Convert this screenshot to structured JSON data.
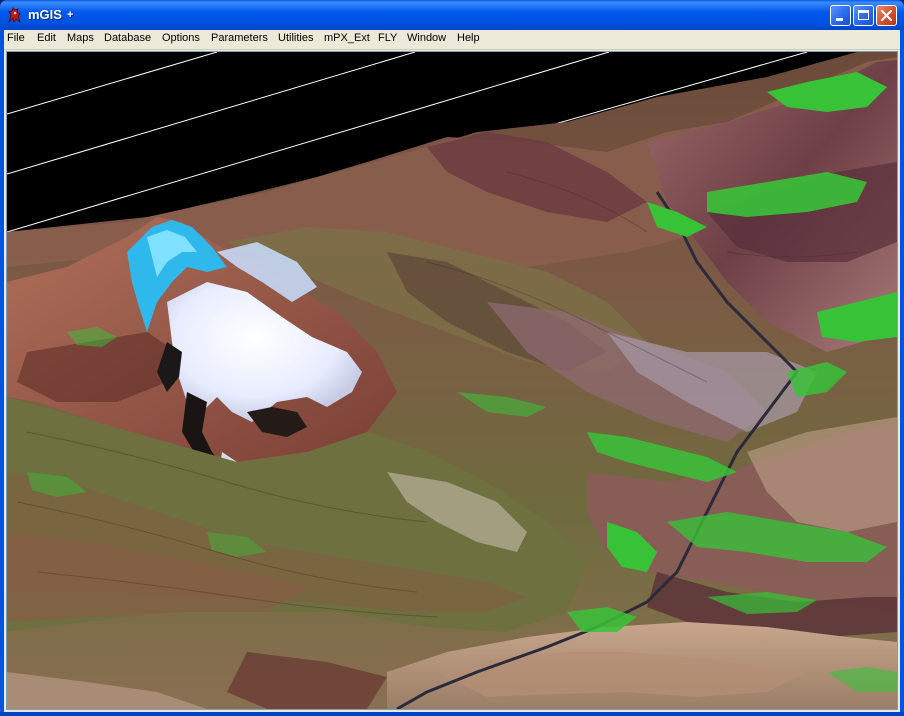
{
  "window": {
    "title": "mGIS",
    "title_suffix": "+",
    "app_icon": "mgis-app-icon",
    "controls": [
      "minimize-icon",
      "maximize-icon",
      "close-icon"
    ]
  },
  "menu": {
    "items": [
      "File",
      "Edit",
      "Maps",
      "Database",
      "Options",
      "Parameters",
      "Utilities",
      "mPX_Ext",
      "FLY",
      "Window",
      "Help"
    ]
  },
  "scene": {
    "kind": "3D terrain fly-through view",
    "features": [
      "snow-capped volcanic peak",
      "river valley with green vegetation",
      "mountain ridges",
      "black sky with white grid lines"
    ]
  },
  "colors": {
    "title_bar": "#0054e3",
    "menu_bg": "#ece9d8",
    "sky": "#000000",
    "snow": "#f4f6ff",
    "peak_cyan": "#39c8f0",
    "vegetation": "#3cc73a",
    "terrain_red": "#9a5a4a",
    "terrain_olive": "#7a7a48"
  }
}
